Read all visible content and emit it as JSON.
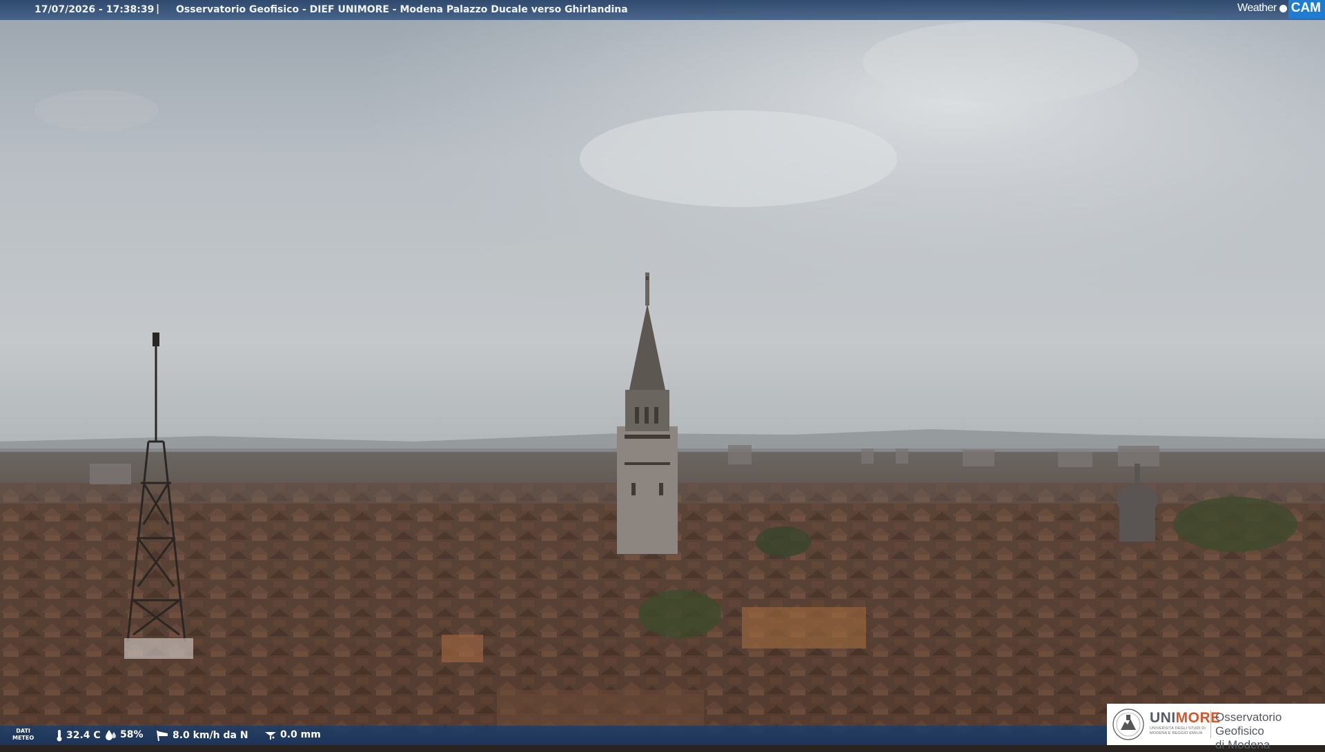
{
  "header": {
    "timestamp": "17/07/2026 - 17:38:39",
    "separator": "|",
    "title": "Osservatorio Geofisico - DIEF UNIMORE - Modena Palazzo Ducale verso Ghirlandina"
  },
  "brand_logo": {
    "weather": "Weather",
    "cam": "CAM",
    "accent_color": "#1e7dd0"
  },
  "weather_data": {
    "label_line1": "DATI",
    "label_line2": "METEO",
    "temperature": "32.4 C",
    "temperature_icon": "thermometer-icon",
    "humidity": "58%",
    "humidity_icon": "droplet-icon",
    "wind": "8.0 km/h da N",
    "wind_icon": "windsock-icon",
    "rain": "0.0 mm",
    "rain_icon": "rain-gauge-icon"
  },
  "org_logo": {
    "uni_part1": "UNI",
    "uni_part2": "MORE",
    "uni_subtitle": "UNIVERSITÀ DEGLI STUDI DI MODENA E REGGIO EMILIA",
    "name_line1": "Osservatorio Geofisico",
    "name_line2": "di Modena",
    "accent_color": "#d9562a"
  },
  "bar_color": "#264268"
}
